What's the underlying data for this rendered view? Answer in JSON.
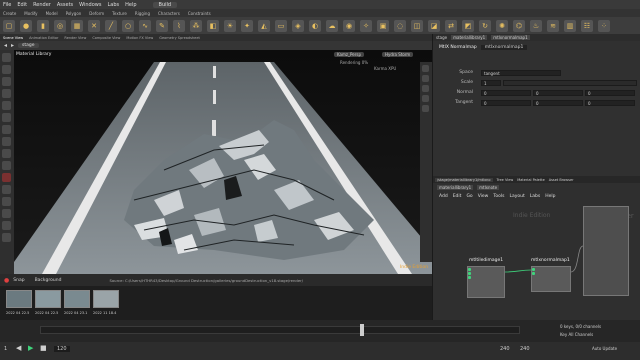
{
  "menu": [
    "File",
    "Edit",
    "Render",
    "Assets",
    "Windows",
    "Labs",
    "Help"
  ],
  "desktop": "Build",
  "shelf_tabs": [
    "Create",
    "Modify",
    "Model",
    "Polygon",
    "Deform",
    "Texture",
    "Rigging",
    "Characters",
    "Constraints"
  ],
  "pane_tabs": [
    "Scene View",
    "Animation Editor",
    "Render View",
    "Composite View",
    "Motion FX View",
    "Geometry Spreadsheet"
  ],
  "viewport": {
    "path": "stage",
    "camera": "Kamz_Persp",
    "renderer": "Hydra Storm",
    "stats_left": "Rendering  0%",
    "stats_right": "Karma XPU",
    "label": "Material Library",
    "engine_label": "Indie Edition"
  },
  "snapshot_bar": {
    "snap": "Snap",
    "background": "Background",
    "path": "Source: C:/Users/HTHR43/Desktop/Ground Destruction/galleries/groundDestruction_v18.stage/render/",
    "thumbs": [
      "2022 04 22.5",
      "2022 04 22.5",
      "2022 04 23.1",
      "2022 11 18.4"
    ]
  },
  "params": {
    "path": "stage",
    "node_a": "materiallibrary1",
    "node_b": "mtlxnormalmap1",
    "node_type": "MtlX Normalmap",
    "node_name": "mtlxnormalmap1",
    "rows": [
      {
        "label": "Space",
        "value": "tangent"
      },
      {
        "label": "Scale",
        "value": "1"
      },
      {
        "label": "Normal",
        "value": "0"
      },
      {
        "label": "Tangent",
        "value": "0"
      }
    ],
    "extra_values": [
      "0",
      "0",
      "0",
      "0"
    ]
  },
  "network": {
    "tabs": [
      "/stage/materiallibrary1/mtlxno",
      "Tree View",
      "Material Palette",
      "Asset Browser"
    ],
    "menu": [
      "Add",
      "Edit",
      "Go",
      "View",
      "Tools",
      "Layout",
      "Labs",
      "Help"
    ],
    "path": "materiallibrary1",
    "path2": "mtlxnote",
    "watermark": "Indie Edition",
    "watermark2": "Builder",
    "nodes": [
      {
        "name": "mtltiledimage1"
      },
      {
        "name": "mtlxnormalmap1"
      }
    ]
  },
  "timeline": {
    "start": "1",
    "end": "240",
    "current": "120",
    "frame_a": "240",
    "frame_b": "240",
    "keys": "0 keys, 0/0 channels",
    "key_all": "Key All Channels",
    "auto_update": "Auto Update"
  },
  "colors": {
    "accent": "#3fd47c",
    "warn": "#e8c060"
  }
}
